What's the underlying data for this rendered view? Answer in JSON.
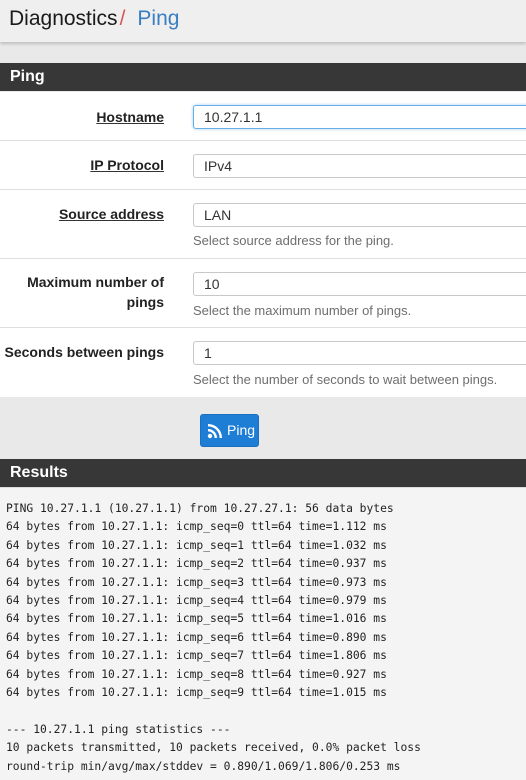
{
  "header": {
    "parent": "Diagnostics",
    "separator": "/",
    "current": "Ping"
  },
  "ping_panel": {
    "title": "Ping",
    "fields": {
      "hostname": {
        "label": "Hostname",
        "value": "10.27.1.1"
      },
      "ip_protocol": {
        "label": "IP Protocol",
        "value": "IPv4"
      },
      "source_address": {
        "label": "Source address",
        "value": "LAN",
        "help": "Select source address for the ping."
      },
      "max_pings": {
        "label_line1": "Maximum number of",
        "label_line2": "pings",
        "value": "10",
        "help": "Select the maximum number of pings."
      },
      "seconds_between": {
        "label": "Seconds between pings",
        "value": "1",
        "help": "Select the number of seconds to wait between pings."
      }
    },
    "button": {
      "label": "Ping",
      "icon": "rss-icon",
      "color": "#1e7ed6"
    }
  },
  "results_panel": {
    "title": "Results",
    "output": "PING 10.27.1.1 (10.27.1.1) from 10.27.27.1: 56 data bytes\n64 bytes from 10.27.1.1: icmp_seq=0 ttl=64 time=1.112 ms\n64 bytes from 10.27.1.1: icmp_seq=1 ttl=64 time=1.032 ms\n64 bytes from 10.27.1.1: icmp_seq=2 ttl=64 time=0.937 ms\n64 bytes from 10.27.1.1: icmp_seq=3 ttl=64 time=0.973 ms\n64 bytes from 10.27.1.1: icmp_seq=4 ttl=64 time=0.979 ms\n64 bytes from 10.27.1.1: icmp_seq=5 ttl=64 time=1.016 ms\n64 bytes from 10.27.1.1: icmp_seq=6 ttl=64 time=0.890 ms\n64 bytes from 10.27.1.1: icmp_seq=7 ttl=64 time=1.806 ms\n64 bytes from 10.27.1.1: icmp_seq=8 ttl=64 time=0.927 ms\n64 bytes from 10.27.1.1: icmp_seq=9 ttl=64 time=1.015 ms\n\n--- 10.27.1.1 ping statistics ---\n10 packets transmitted, 10 packets received, 0.0% packet loss\nround-trip min/avg/max/stddev = 0.890/1.069/1.806/0.253 ms"
  },
  "colors": {
    "panel_heading": "#373737",
    "breadcrumb_current": "#3a7ec2",
    "breadcrumb_separator": "#d9534f"
  }
}
